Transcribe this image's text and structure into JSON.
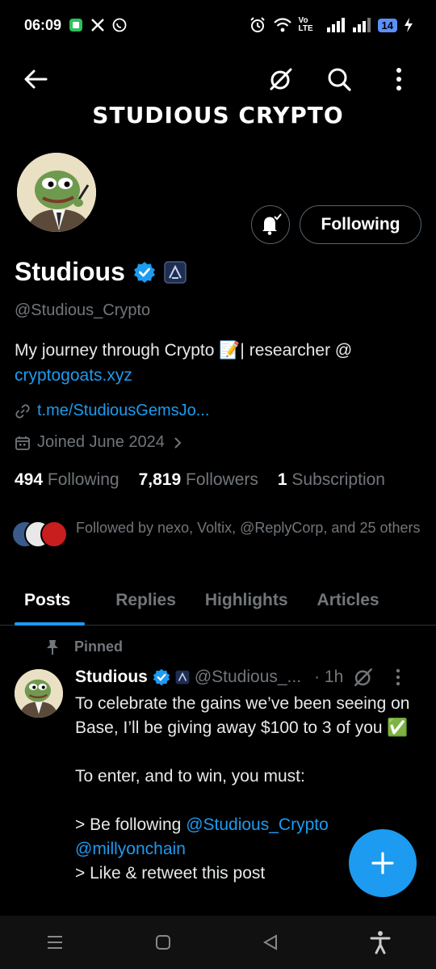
{
  "status_bar": {
    "time": "06:09",
    "network_label": "Vo LTE",
    "battery": "14"
  },
  "header": {
    "banner_title": "STUDIOUS CRYPTO"
  },
  "profile": {
    "name": "Studious",
    "handle": "@Studious_Crypto",
    "bio_text": "My journey through Crypto 📝| researcher @",
    "bio_link": "cryptogoats.xyz",
    "website": "t.me/StudiousGemsJo...",
    "joined": "Joined June 2024",
    "follow_button": "Following",
    "stats": {
      "following_count": "494",
      "following_label": "Following",
      "followers_count": "7,819",
      "followers_label": "Followers",
      "subscription_count": "1",
      "subscription_label": "Subscription"
    },
    "followed_by": "Followed by nexo, Voltix, @ReplyCorp, and 25 others"
  },
  "tabs": [
    {
      "label": "Posts",
      "active": true
    },
    {
      "label": "Replies",
      "active": false
    },
    {
      "label": "Highlights",
      "active": false
    },
    {
      "label": "Articles",
      "active": false
    }
  ],
  "pinned_post": {
    "pinned_label": "Pinned",
    "author_name": "Studious",
    "author_handle": "@Studious_...",
    "time": "· 1h",
    "line1": "To celebrate the gains we’ve been seeing on Base, I’ll be giving away $100 to 3 of you ✅",
    "line2": "To enter, and to win, you must:",
    "line3_prefix": "> Be following",
    "mention1": "@Studious_Crypto",
    "mention2": "@millyonchain",
    "line4": "> Like & retweet this post"
  },
  "colors": {
    "accent": "#1d9bf0",
    "background": "#000000",
    "muted": "#71767b"
  }
}
